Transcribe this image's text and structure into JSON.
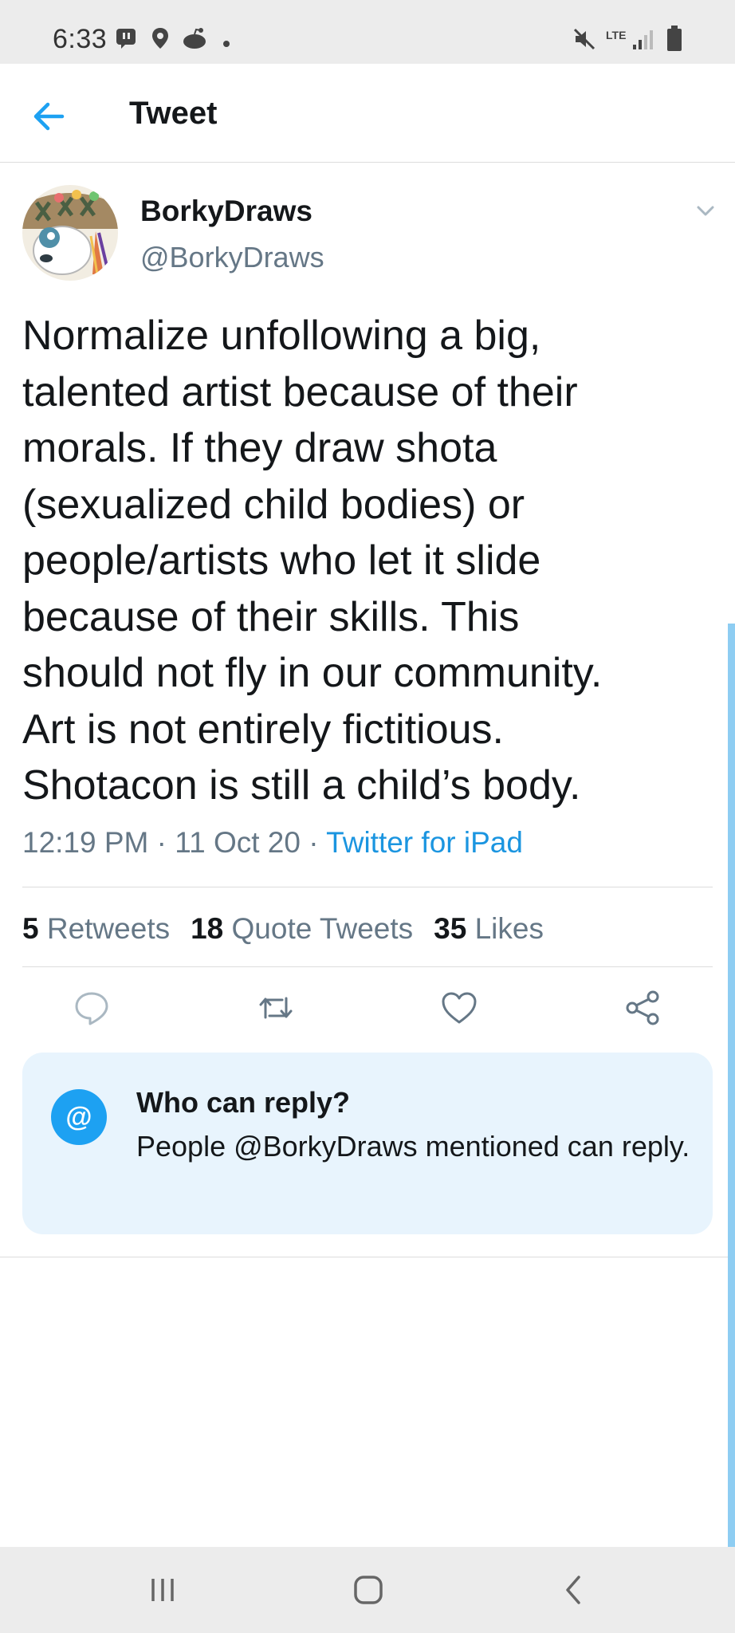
{
  "status_bar": {
    "time": "6:33",
    "network": "LTE"
  },
  "header": {
    "title": "Tweet",
    "back_icon": "arrow-left-icon"
  },
  "tweet": {
    "author_name": "BorkyDraws",
    "author_handle": "@BorkyDraws",
    "text_lines": [
      "Normalize unfollowing a big,",
      "talented artist because of their",
      "morals.  If they draw shota",
      "(sexualized child bodies) or",
      "people/artists who let it slide",
      "because of their skills.  This",
      "should not fly in our community.",
      "Art is not entirely fictitious.",
      "Shotacon is still a child’s body."
    ],
    "time": "12:19 PM",
    "date": "11 Oct 20",
    "separator": " · ",
    "source": "Twitter for iPad"
  },
  "stats": {
    "retweets_count": "5",
    "retweets_label": "Retweets",
    "quotes_count": "18",
    "quotes_label": "Quote Tweets",
    "likes_count": "35",
    "likes_label": "Likes"
  },
  "actions": [
    "reply-icon",
    "retweet-icon",
    "like-icon",
    "share-icon"
  ],
  "reply_card": {
    "icon_text": "@",
    "title": "Who can reply?",
    "description": "People @BorkyDraws mentioned can reply."
  },
  "colors": {
    "accent": "#1da1f2",
    "link": "#1b95e0",
    "secondary_text": "#657786",
    "card_bg": "#e8f4fd"
  }
}
